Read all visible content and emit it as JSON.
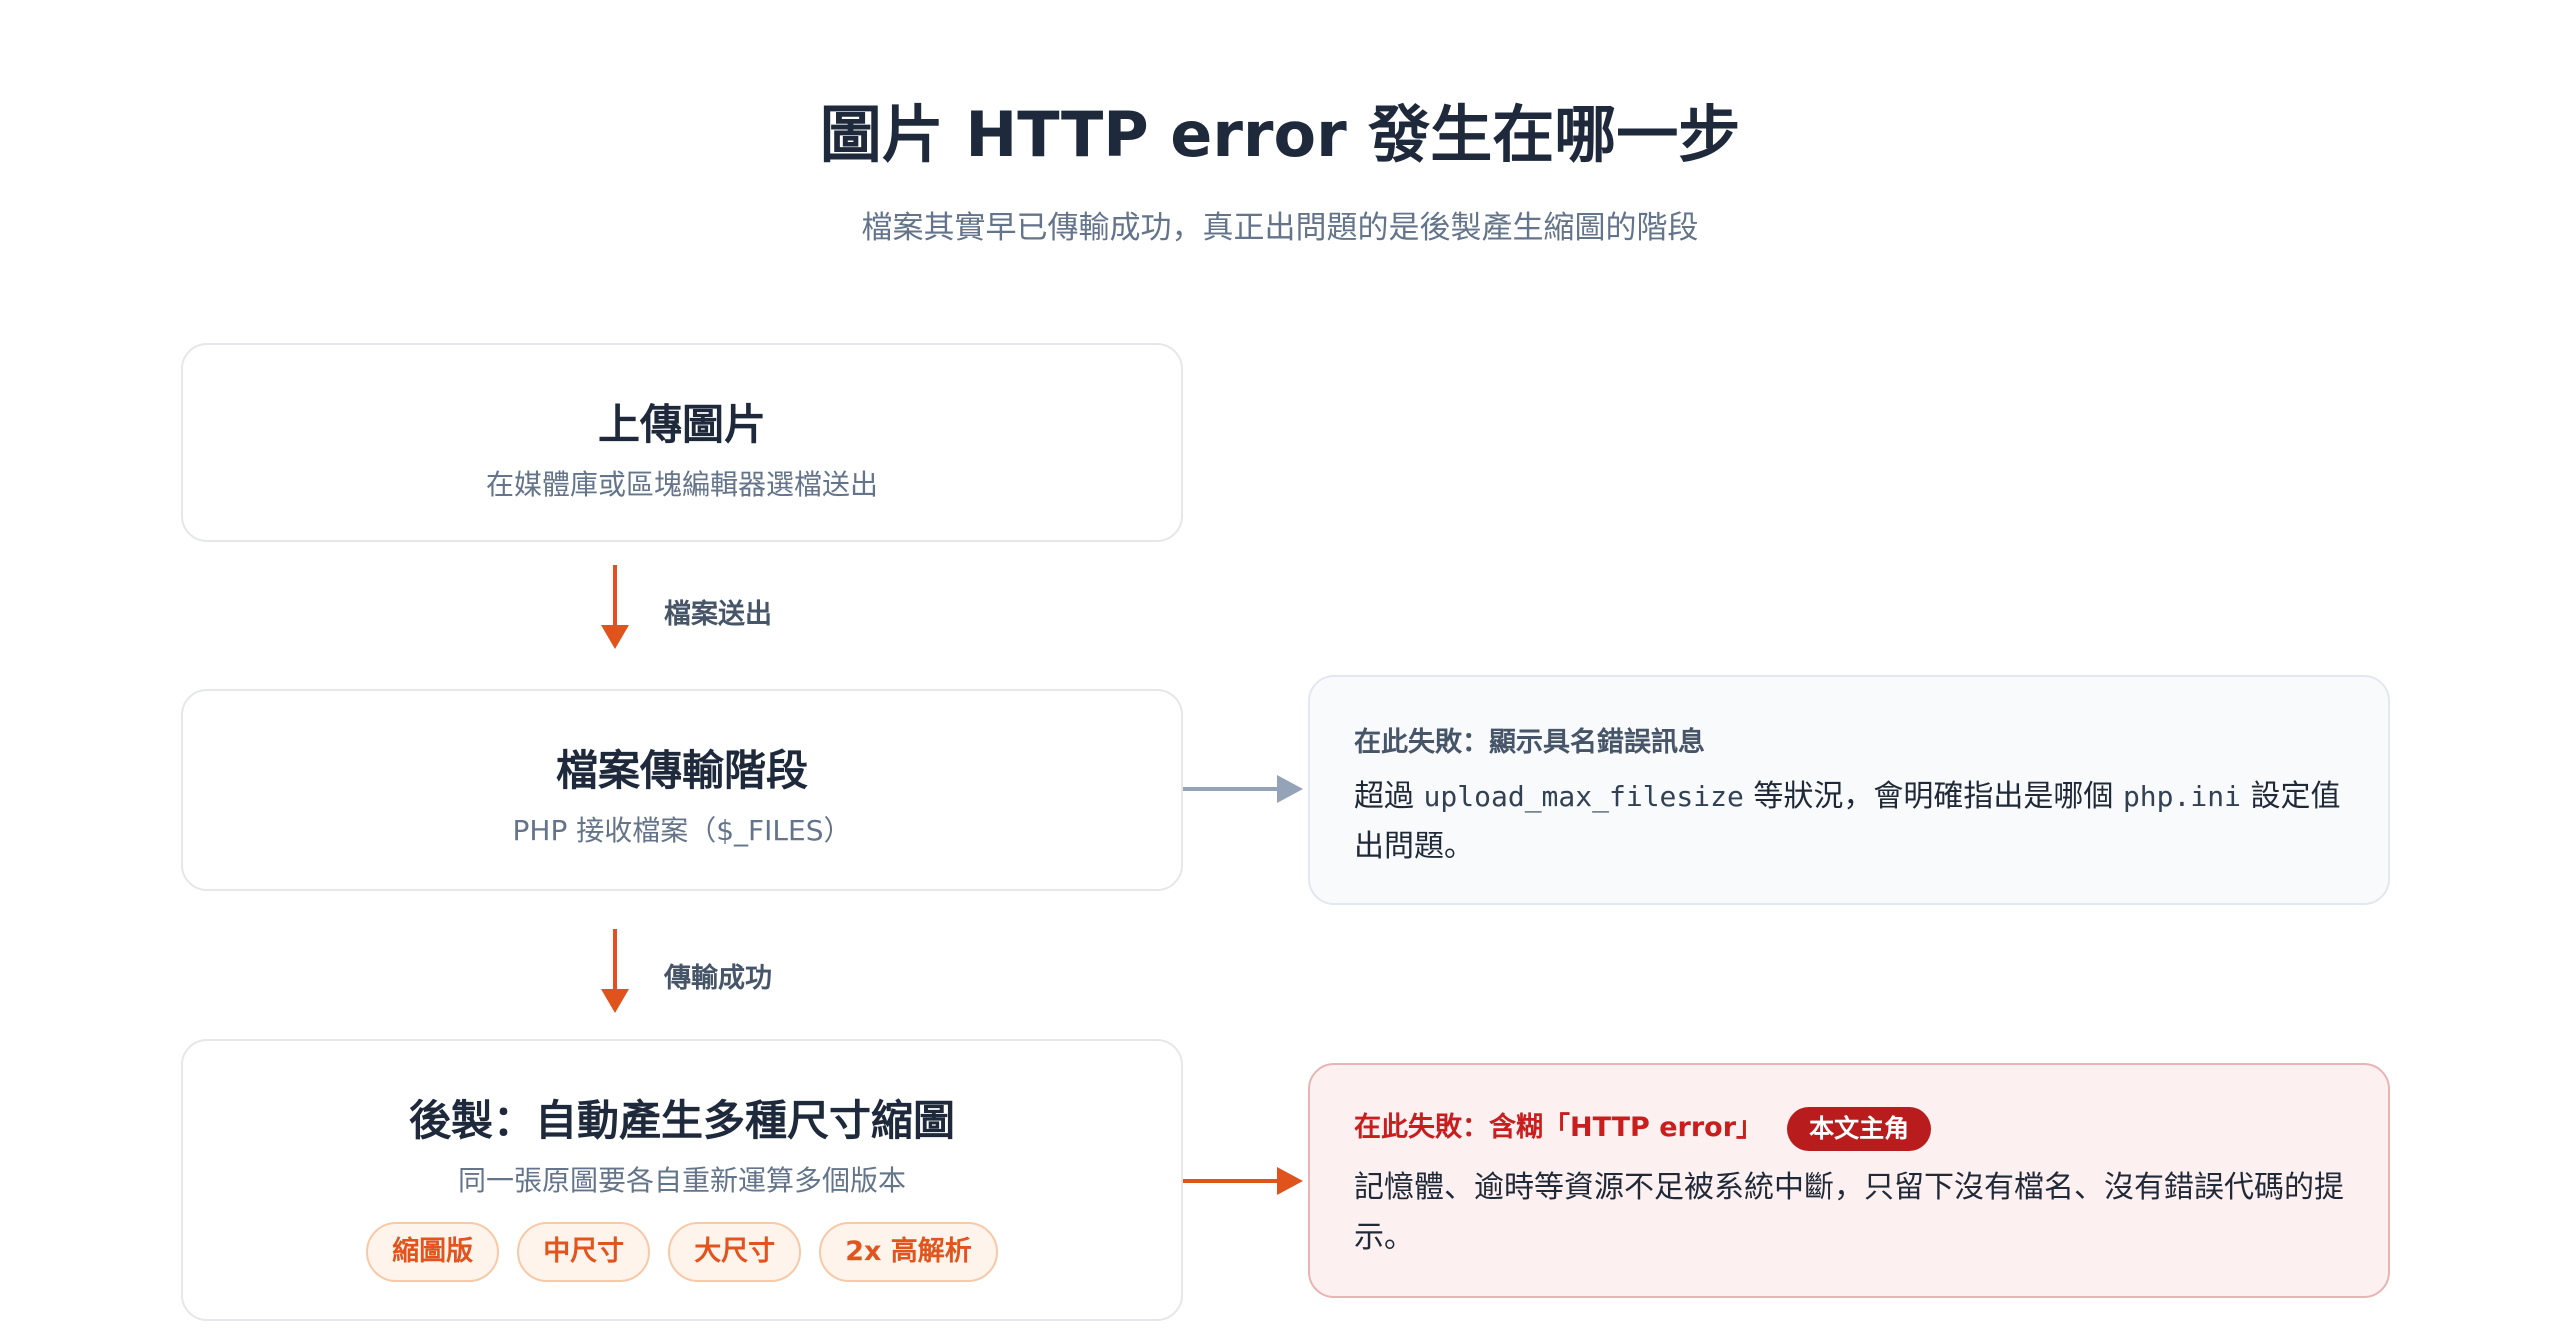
{
  "header": {
    "title": "圖片 HTTP error 發生在哪一步",
    "subtitle": "檔案其實早已傳輸成功，真正出問題的是後製產生縮圖的階段"
  },
  "steps": [
    {
      "title": "上傳圖片",
      "description": "在媒體庫或區塊編輯器選檔送出"
    },
    {
      "title": "檔案傳輸階段",
      "description": "PHP 接收檔案（$_FILES）"
    },
    {
      "title": "後製：自動產生多種尺寸縮圖",
      "description": "同一張原圖要各自重新運算多個版本",
      "tags": [
        "縮圖版",
        "中尺寸",
        "大尺寸",
        "2x 高解析"
      ]
    }
  ],
  "connectors": [
    {
      "label": "檔案送出"
    },
    {
      "label": "傳輸成功"
    }
  ],
  "failures": [
    {
      "heading": "在此失敗：顯示具名錯誤訊息",
      "body_prefix": "超過",
      "body_code_1": "upload_max_filesize",
      "body_middle": "等狀況，會明確指出是哪個",
      "body_code_2": "php.ini",
      "body_suffix": "設定值出問題。"
    },
    {
      "heading": "在此失敗：含糊「HTTP error」",
      "badge": "本文主角",
      "body": "記憶體、逾時等資源不足被系統中斷，只留下沒有檔名、沒有錯誤代碼的提示。"
    }
  ],
  "colors": {
    "accent": "#e0531d",
    "neutral_arrow": "#94a3b8",
    "error_text": "#c81e1e",
    "badge_bg": "#b91c1c"
  }
}
